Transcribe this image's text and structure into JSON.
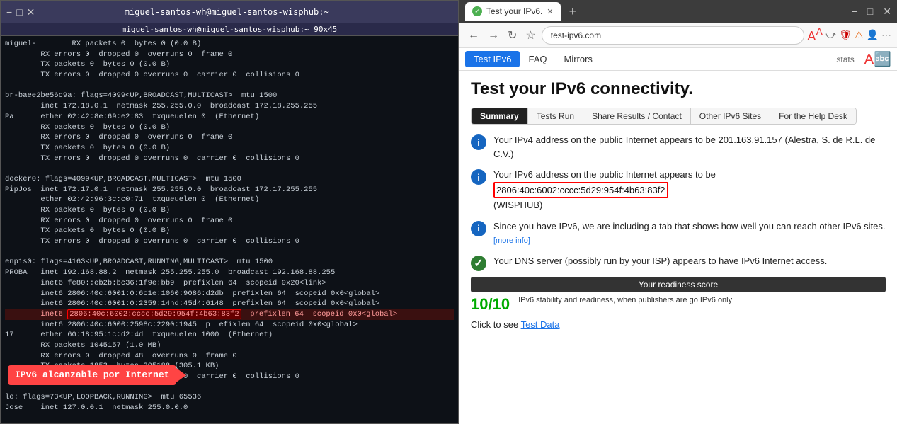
{
  "terminal": {
    "title": "miguel-santos-wh@miguel-santos-wisphub:~",
    "subtitle": "miguel-santos-wh@miguel-santos-wisphub:~ 90x45",
    "controls": [
      "−",
      "□",
      "✕"
    ],
    "lines": [
      "miguel-        RX packets 0  bytes 0 (0.0 B)",
      "        RX errors 0  dropped 0  overruns 0  frame 0",
      "        TX packets 0  bytes 0 (0.0 B)",
      "        TX errors 0  dropped 0 overruns 0  carrier 0  collisions 0",
      "",
      "br-baee2be56c9a: flags=4099<UP,BROADCAST,MULTICAST>  mtu 1500",
      "        inet 172.18.0.1  netmask 255.255.0.0  broadcast 172.18.255.255",
      "Pa      ether 02:42:8e:69:e2:83  txqueuelen 0  (Ethernet)",
      "        RX packets 0  bytes 0 (0.0 B)",
      "        RX errors 0  dropped 0  overruns 0  frame 0",
      "        TX packets 0  bytes 0 (0.0 B)",
      "        TX errors 0  dropped 0 overruns 0  carrier 0  collisions 0",
      "",
      "docker0: flags=4099<UP,BROADCAST,MULTICAST>  mtu 1500",
      "PipJos  inet 172.17.0.1  netmask 255.255.0.0  broadcast 172.17.255.255",
      "        ether 02:42:96:3c:c0:71  txqueuelen 0  (Ethernet)",
      "        RX packets 0  bytes 0 (0.0 B)",
      "        RX errors 0  dropped 0  overruns 0  frame 0",
      "        TX packets 0  bytes 0 (0.0 B)",
      "        TX errors 0  dropped 0 overruns 0  carrier 0  collisions 0",
      "",
      "enp1s0: flags=4163<UP,BROADCAST,RUNNING,MULTICAST>  mtu 1500",
      "PROBA   inet 192.168.88.2  netmask 255.255.255.0  broadcast 192.168.88.255",
      "        inet6 fe80::eb2b:bc36:1f9e:bb9  prefixlen 64  scopeid 0x20<link>",
      "        inet6 2806:40c:6001:0:6c1e:1060:9086:d2db  prefixlen 64  scopeid 0x0<global>",
      "        inet6 2806:40c:6001:0:2359:14hd:45d4:6148  prefixlen 64  scopeid 0x0<global>",
      "        inet6 2806:40c:6002:cccc:5d29:954f:4b63:83f2  prefixlen 64  scopeid 0x0<global>",
      "        inet6 2806:40c:6000:2598c:2290:1945  p  efixlen 64  scopeid 0x0<global>",
      "17      ether 60:18:95:1c:d2:4d  txqueuelen 1000  (Ethernet)",
      "        RX packets 1045157 (1.0 MB)",
      "        RX errors 0  dropped 48  overruns 0  frame 0",
      "        TX packets 1853  bytes 305188 (305.1 KB)",
      "        TX errors 8  dropped 0 overruns 0  carrier 0  collisions 0",
      "",
      "lo: flags=73<UP,LOOPBACK,RUNNING>  mtu 65536",
      "Jose    inet 127.0.0.1  netmask 255.0.0.0"
    ]
  },
  "browser": {
    "tab_title": "Test your IPv6.",
    "tab_close": "✕",
    "tab_new": "+",
    "address": "test-ipv6.com",
    "nav_buttons": [
      "←",
      "→",
      "↺",
      "☆"
    ],
    "translate_icon": "A→",
    "nav_tabs": [
      {
        "label": "Test IPv6",
        "active": true
      },
      {
        "label": "FAQ",
        "active": false
      },
      {
        "label": "Mirrors",
        "active": false
      }
    ],
    "stats_label": "stats",
    "translate_symbol": "A🅐",
    "page_title": "Test your IPv6 connectivity.",
    "content_tabs": [
      {
        "label": "Summary",
        "active": true
      },
      {
        "label": "Tests Run",
        "active": false
      },
      {
        "label": "Share Results / Contact",
        "active": false
      },
      {
        "label": "Other IPv6 Sites",
        "active": false
      },
      {
        "label": "For the Help Desk",
        "active": false
      }
    ],
    "cards": [
      {
        "icon": "i",
        "icon_type": "blue",
        "text": "Your IPv4 address on the public Internet appears to be 201.163.91.157 (Alestra, S. de R.L. de C.V.)"
      },
      {
        "icon": "i",
        "icon_type": "blue",
        "text_prefix": "Your IPv6 address on the public Internet appears to be ",
        "ipv6": "2806:40c:6002:cccc:5d29:954f:4b63:83f2",
        "text_suffix": " (WISPHUB)"
      },
      {
        "icon": "i",
        "icon_type": "blue",
        "text": "Since you have IPv6, we are including a tab that shows how well you can reach other IPv6 sites.",
        "more_info": "[more info]"
      },
      {
        "icon": "✓",
        "icon_type": "green",
        "text": "Your DNS server (possibly run by your ISP) appears to have IPv6 Internet access."
      }
    ],
    "readiness_label": "Your readiness score",
    "readiness_desc": "IPv6 stability and readiness, when publishers are go IPv6 only",
    "score": "10/10",
    "test_data_prefix": "Click to see ",
    "test_data_link": "Test Data",
    "annotation_text": "IPv6 alcanzable por Internet"
  }
}
